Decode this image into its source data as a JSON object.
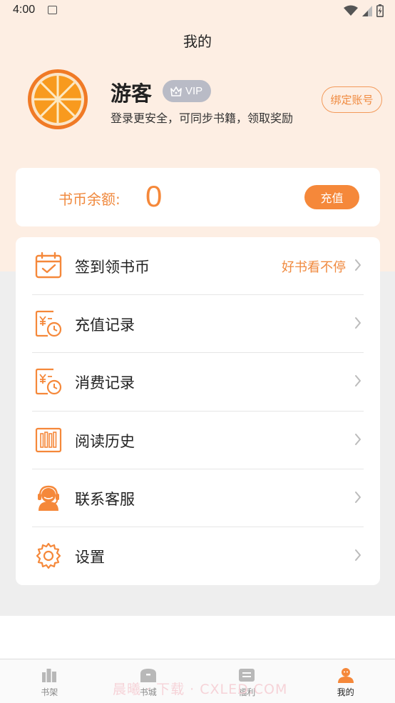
{
  "status_bar": {
    "time": "4:00"
  },
  "header": {
    "title": "我的"
  },
  "profile": {
    "username": "游客",
    "vip_label": "VIP",
    "subtitle": "登录更安全，可同步书籍，领取奖励",
    "bind_button": "绑定账号"
  },
  "balance": {
    "label": "书币余额:",
    "value": "0",
    "recharge_button": "充值"
  },
  "menu": {
    "items": [
      {
        "label": "签到领书币",
        "hint": "好书看不停",
        "icon": "calendar-check-icon"
      },
      {
        "label": "充值记录",
        "hint": "",
        "icon": "yuan-clock-icon"
      },
      {
        "label": "消费记录",
        "hint": "",
        "icon": "yuan-clock-icon"
      },
      {
        "label": "阅读历史",
        "hint": "",
        "icon": "books-icon"
      },
      {
        "label": "联系客服",
        "hint": "",
        "icon": "headset-icon"
      },
      {
        "label": "设置",
        "hint": "",
        "icon": "gear-icon"
      }
    ]
  },
  "bottom_nav": {
    "items": [
      {
        "label": "书架",
        "icon": "bookshelf-icon",
        "active": false
      },
      {
        "label": "书城",
        "icon": "bookstore-icon",
        "active": false
      },
      {
        "label": "福利",
        "icon": "welfare-icon",
        "active": false
      },
      {
        "label": "我的",
        "icon": "profile-icon",
        "active": true
      }
    ]
  },
  "watermark": "晨曦 · 下载 · CXLED.COM",
  "colors": {
    "accent": "#f5883a",
    "header_bg": "#fdeee3",
    "page_bg": "#eeeeee",
    "vip_badge": "#b9bbc6"
  }
}
